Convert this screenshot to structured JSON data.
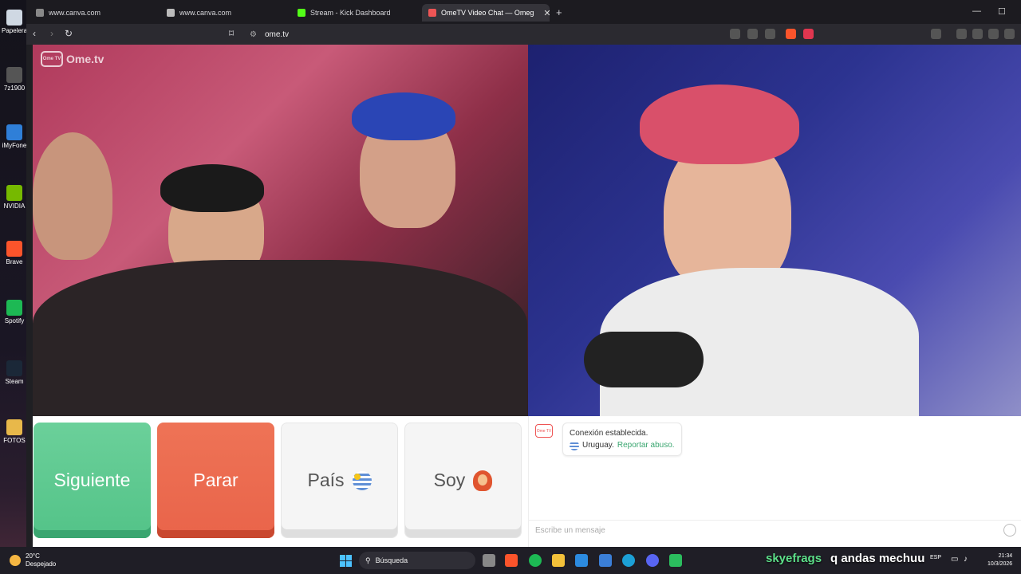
{
  "desktop": {
    "icons": [
      {
        "label": "Papelera de reciclaje"
      },
      {
        "label": "7z1900"
      },
      {
        "label": "iMyFone"
      },
      {
        "label": "NVIDIA"
      },
      {
        "label": "Brave"
      },
      {
        "label": "Spotify"
      },
      {
        "label": "Steam"
      },
      {
        "label": "FOTOS"
      }
    ]
  },
  "browser": {
    "tabs": [
      {
        "title": "www.canva.com"
      },
      {
        "title": "www.canva.com"
      },
      {
        "title": "Stream - Kick Dashboard"
      },
      {
        "title": "OmeTV Video Chat — Omeg"
      }
    ],
    "url": "ome.tv"
  },
  "page": {
    "logo_text": "Ome.tv",
    "logo_tv_text": "Ome TV",
    "buttons": {
      "next": "Siguiente",
      "stop": "Parar",
      "country": "País",
      "gender": "Soy"
    },
    "chat": {
      "status": "Conexión establecida.",
      "country": "Uruguay.",
      "report": "Reportar abuso.",
      "input_placeholder": "Escribe un mensaje"
    }
  },
  "taskbar": {
    "temperature": "20°C",
    "weather": "Despejado",
    "search_placeholder": "Búsqueda",
    "language": "ESP",
    "time": "21:34",
    "date": "10/3/2026"
  },
  "overlay": {
    "username": "skyefrags",
    "message": "q andas mechuu"
  },
  "colors": {
    "next": "#53c388",
    "stop": "#e9644a",
    "report_link": "#3aa670"
  }
}
